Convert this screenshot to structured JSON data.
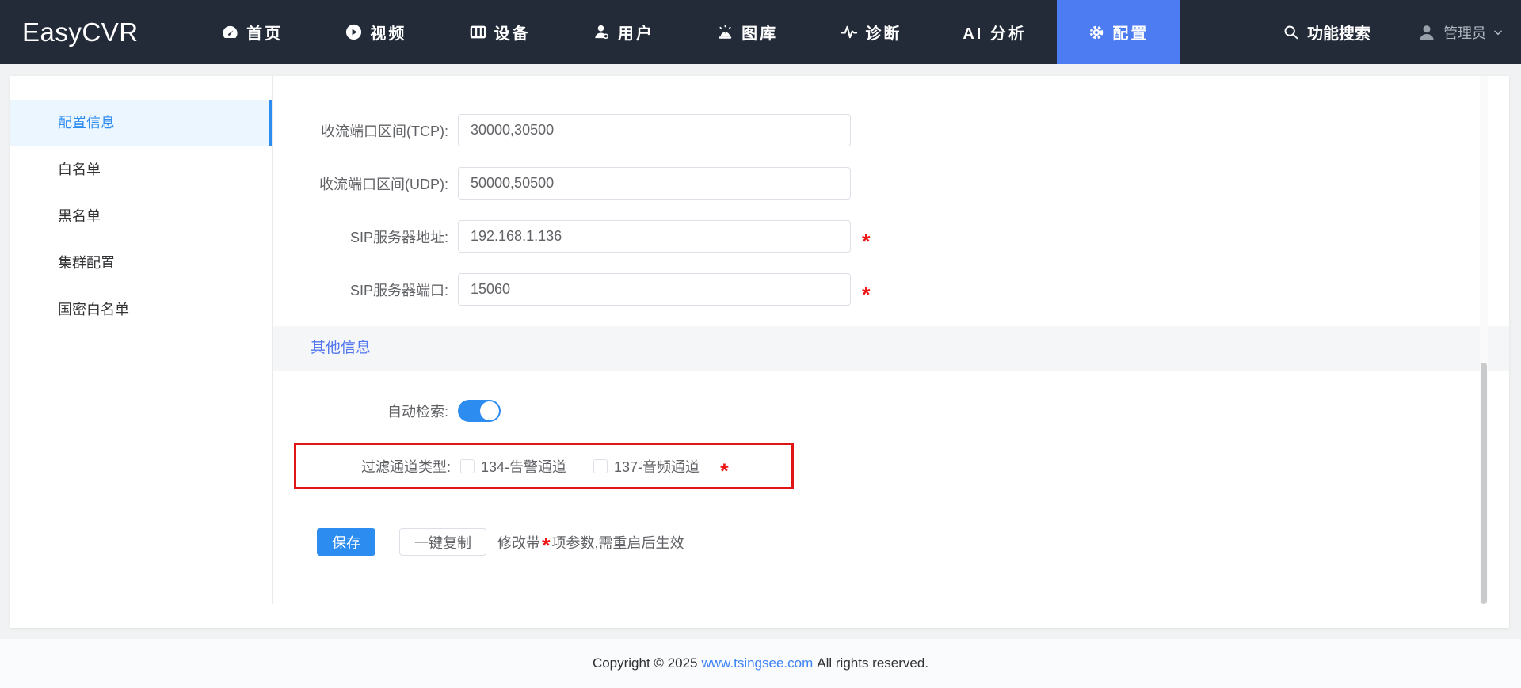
{
  "brand": "EasyCVR",
  "navbar": {
    "items": [
      {
        "label": "首页",
        "icon": "dashboard-icon"
      },
      {
        "label": "视频",
        "icon": "video-icon"
      },
      {
        "label": "设备",
        "icon": "device-icon"
      },
      {
        "label": "用户",
        "icon": "user-icon"
      },
      {
        "label": "图库",
        "icon": "gallery-icon"
      },
      {
        "label": "诊断",
        "icon": "diagnosis-icon"
      },
      {
        "label": "AI 分析",
        "icon": ""
      },
      {
        "label": "配置",
        "icon": "gear-icon",
        "active": true
      }
    ],
    "search_label": "功能搜索",
    "user_label": "管理员"
  },
  "sidebar": {
    "items": [
      {
        "label": "配置信息",
        "active": true
      },
      {
        "label": "白名单",
        "active": false
      },
      {
        "label": "黑名单",
        "active": false
      },
      {
        "label": "集群配置",
        "active": false
      },
      {
        "label": "国密白名单",
        "active": false
      }
    ]
  },
  "form": {
    "fields": [
      {
        "label": "收流端口区间(TCP):",
        "value": "30000,30500",
        "required": false
      },
      {
        "label": "收流端口区间(UDP):",
        "value": "50000,50500",
        "required": false
      },
      {
        "label": "SIP服务器地址:",
        "value": "192.168.1.136",
        "required": true
      },
      {
        "label": "SIP服务器端口:",
        "value": "15060",
        "required": true
      }
    ],
    "section_title": "其他信息",
    "auto_search_label": "自动检索:",
    "auto_search_on": true,
    "filter_label": "过滤通道类型:",
    "filter_options": [
      {
        "label": "134-告警通道",
        "checked": false
      },
      {
        "label": "137-音频通道",
        "checked": false
      }
    ],
    "required_mark": "*",
    "save_label": "保存",
    "copy_label": "一键复制",
    "note_prefix": "修改带",
    "note_suffix": "项参数,需重启后生效"
  },
  "footer": {
    "prefix": "Copyright © 2025",
    "link": "www.tsingsee.com",
    "suffix": "All rights reserved."
  },
  "colors": {
    "navbar_bg": "#232b39",
    "active_tab": "#4d7bf2",
    "primary": "#2d8cf0",
    "section_title": "#5276f0",
    "required_red": "#f01414",
    "highlight_border_red": "#e01616",
    "link_blue": "#3e82f7"
  }
}
